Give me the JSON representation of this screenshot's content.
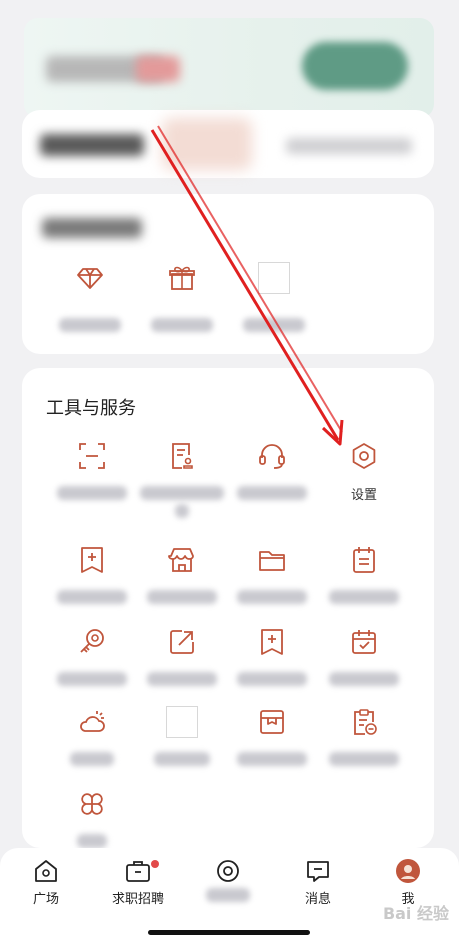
{
  "tools": {
    "title": "工具与服务",
    "settings_label": "设置"
  },
  "nav": {
    "tabs": [
      "广场",
      "求职招聘",
      "消息",
      "我"
    ]
  },
  "watermark": "Bai 经验",
  "colors": {
    "accent": "#c0563c",
    "annotation": "#e02020"
  }
}
